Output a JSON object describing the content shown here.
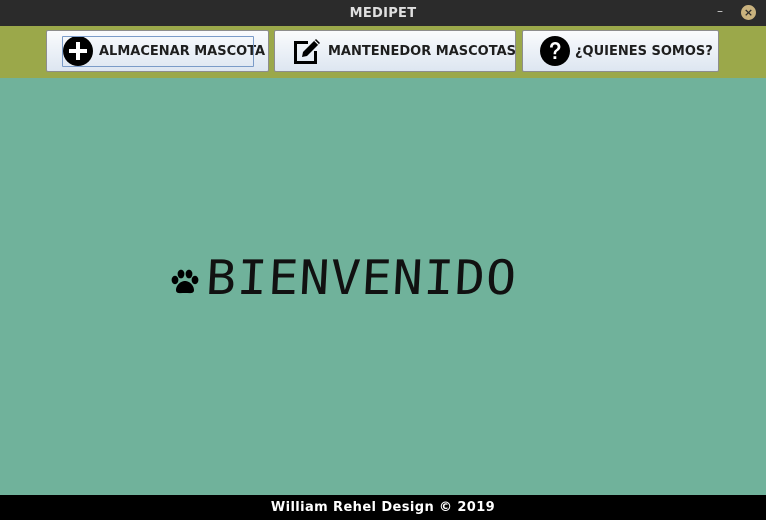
{
  "window": {
    "title": "MEDIPET",
    "minimize_glyph": "–",
    "close_glyph": "×"
  },
  "toolbar": {
    "buttons": [
      {
        "label": "ALMACENAR MASCOTA",
        "icon": "plus-circle-icon"
      },
      {
        "label": "MANTENEDOR MASCOTAS",
        "icon": "edit-icon"
      },
      {
        "label": "¿QUIENES SOMOS?",
        "icon": "question-circle-icon"
      }
    ]
  },
  "main": {
    "welcome_text": "BIENVENIDO",
    "welcome_icon": "paw-icon"
  },
  "footer": {
    "text": "William Rehel Design © 2019"
  },
  "colors": {
    "titlebar": "#2b2b2b",
    "toolbar": "#9ba84a",
    "main_background": "#70b29b",
    "footer": "#000000"
  }
}
